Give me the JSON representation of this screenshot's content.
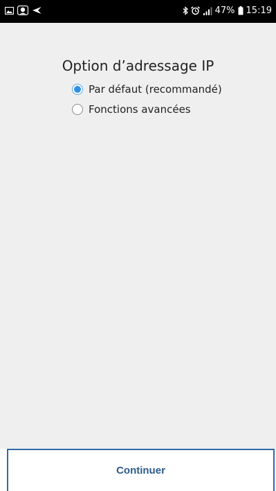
{
  "status_bar": {
    "battery": "47%",
    "time": "15:19",
    "left_icons": [
      "image-icon",
      "smiley-notification-icon",
      "send-icon"
    ],
    "right_icons": [
      "bluetooth-icon",
      "alarm-icon",
      "signal-icon",
      "battery-icon"
    ]
  },
  "page": {
    "title": "Option d’adressage IP"
  },
  "options": [
    {
      "label": "Par défaut (recommandé)",
      "selected": true
    },
    {
      "label": "Fonctions avancées",
      "selected": false
    }
  ],
  "footer": {
    "continue_label": "Continuer"
  },
  "colors": {
    "background": "#efefef",
    "accent": "#2f8fe3",
    "button_border": "#2e6aa8",
    "button_text": "#2c5a8c"
  }
}
